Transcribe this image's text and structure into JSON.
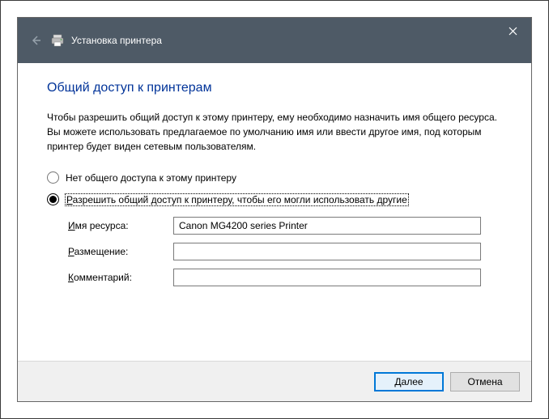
{
  "titlebar": {
    "title": "Установка принтера"
  },
  "heading": "Общий доступ к принтерам",
  "intro": "Чтобы разрешить общий доступ к этому принтеру, ему необходимо назначить имя общего ресурса. Вы можете использовать предлагаемое по умолчанию имя или ввести другое имя, под которым принтер будет виден сетевым пользователям.",
  "radios": {
    "no_share": "Нет общего доступа к этому принтеру",
    "share_prefix": "Р",
    "share_rest": "азрешить общий доступ к принтеру, чтобы его могли использовать другие"
  },
  "fields": {
    "share_name_label_accel": "И",
    "share_name_label_rest": "мя ресурса:",
    "share_name_value": "Canon MG4200 series Printer",
    "location_label_accel": "Р",
    "location_label_rest": "азмещение:",
    "location_value": "",
    "comment_label_accel": "К",
    "comment_label_rest": "омментарий:",
    "comment_value": ""
  },
  "buttons": {
    "next_accel": "Д",
    "next_rest": "алее",
    "cancel": "Отмена"
  }
}
